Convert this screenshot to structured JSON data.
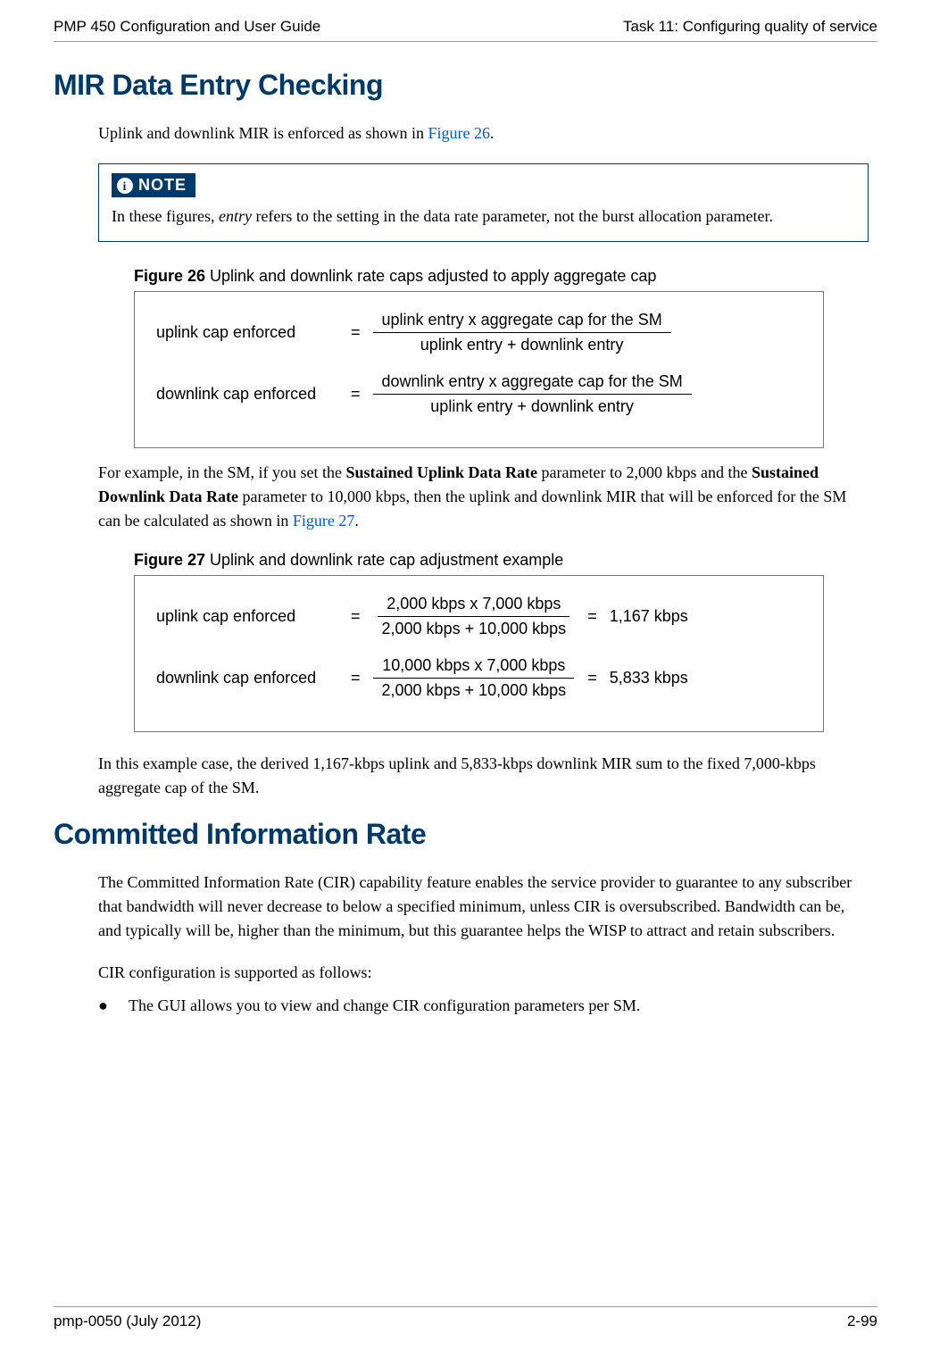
{
  "header": {
    "left": "PMP 450 Configuration and User Guide",
    "right": "Task 11: Configuring quality of service"
  },
  "section1": {
    "title": "MIR Data Entry Checking",
    "intro_part1": "Uplink and downlink MIR is enforced as shown in ",
    "intro_link": "Figure 26",
    "intro_part2": "."
  },
  "note": {
    "badge": "NOTE",
    "text_before": "In these figures, ",
    "text_em": "entry",
    "text_after": " refers to the setting in the data rate parameter, not the burst allocation parameter."
  },
  "figure26": {
    "label_bold": "Figure 26",
    "label_rest": " Uplink and downlink rate caps adjusted to apply aggregate cap",
    "eq1": {
      "lhs": "uplink cap  enforced",
      "num": "uplink entry  x  aggregate cap for the SM",
      "den": "uplink entry  +   downlink entry"
    },
    "eq2": {
      "lhs": "downlink cap enforced",
      "num": "downlink entry  x  aggregate cap for the SM",
      "den": "uplink entry  +   downlink entry"
    }
  },
  "example_para": {
    "t1": "For example, in the SM, if you set the ",
    "b1": "Sustained Uplink Data Rate",
    "t2": " parameter to 2,000 kbps and the ",
    "b2": "Sustained Downlink Data Rate",
    "t3": " parameter to 10,000 kbps, then the uplink and downlink MIR that will be enforced for the SM can be calculated as shown in ",
    "link": "Figure 27",
    "t4": "."
  },
  "figure27": {
    "label_bold": "Figure 27",
    "label_rest": " Uplink and downlink rate cap adjustment example",
    "eq1": {
      "lhs": "uplink cap enforced",
      "num": "2,000 kbps  x  7,000 kbps",
      "den": "2,000 kbps  +   10,000 kbps",
      "result": "1,167 kbps"
    },
    "eq2": {
      "lhs": "downlink cap enforced",
      "num": "10,000 kbps  x  7,000 kbps",
      "den": "2,000 kbps  +   10,000 kbps",
      "result": "5,833 kbps"
    }
  },
  "example_conclusion": "In this example case, the derived 1,167-kbps uplink and 5,833-kbps downlink MIR sum to the fixed 7,000-kbps aggregate cap of the SM.",
  "section2": {
    "title": "Committed Information Rate",
    "para1": "The Committed Information Rate (CIR) capability feature enables the service provider to guarantee to any subscriber that bandwidth will never decrease to below a specified minimum, unless CIR is oversubscribed. Bandwidth can be, and typically will be, higher than the minimum, but this guarantee helps the WISP to attract and retain subscribers.",
    "para2": "CIR configuration is supported as follows:",
    "bullet1": "The GUI allows you to view and change CIR configuration parameters per SM."
  },
  "footer": {
    "left": "pmp-0050 (July 2012)",
    "right": "2-99"
  }
}
